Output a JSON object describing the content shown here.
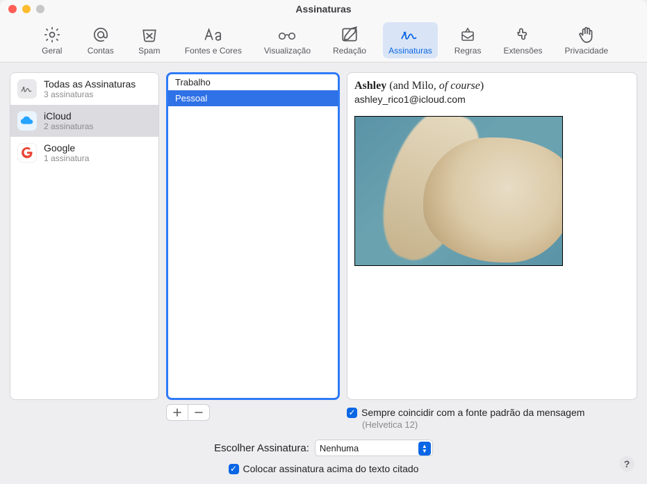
{
  "window": {
    "title": "Assinaturas"
  },
  "toolbar": {
    "general": "Geral",
    "accounts": "Contas",
    "junk": "Spam",
    "fonts": "Fontes e Cores",
    "preview": "Visualização",
    "compose": "Redação",
    "signatures": "Assinaturas",
    "rules": "Regras",
    "extensions": "Extensões",
    "privacy": "Privacidade"
  },
  "accounts": [
    {
      "icon": "signature",
      "name": "Todas as Assinaturas",
      "sub": "3 assinaturas"
    },
    {
      "icon": "icloud",
      "name": "iCloud",
      "sub": "2 assinaturas"
    },
    {
      "icon": "google",
      "name": "Google",
      "sub": "1 assinatura"
    }
  ],
  "signatures": [
    "Trabalho",
    "Pessoal"
  ],
  "preview": {
    "name": "Ashley",
    "paren1": " (and Milo, ",
    "italic": "of course",
    "paren2": ")",
    "email": "ashley_rico1@icloud.com"
  },
  "match": {
    "label": "Sempre coincidir com a fonte padrão da mensagem",
    "sub": "(Helvetica 12)"
  },
  "choose": {
    "label": "Escolher Assinatura:",
    "value": "Nenhuma"
  },
  "place": {
    "label": "Colocar assinatura acima do texto citado"
  }
}
